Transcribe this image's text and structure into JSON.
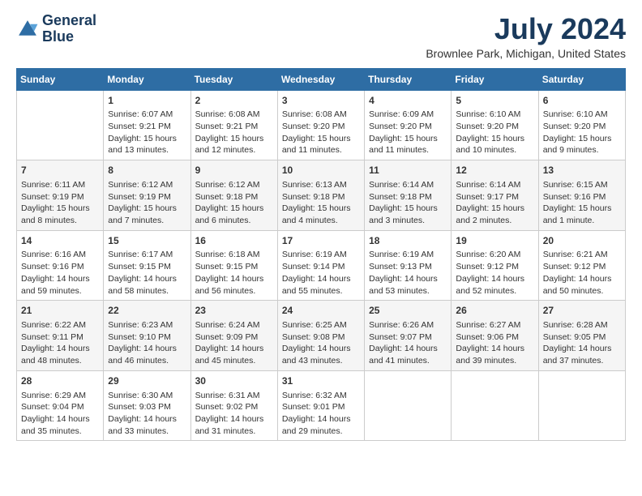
{
  "header": {
    "logo_line1": "General",
    "logo_line2": "Blue",
    "month_year": "July 2024",
    "location": "Brownlee Park, Michigan, United States"
  },
  "weekdays": [
    "Sunday",
    "Monday",
    "Tuesday",
    "Wednesday",
    "Thursday",
    "Friday",
    "Saturday"
  ],
  "weeks": [
    [
      {
        "day": "",
        "content": ""
      },
      {
        "day": "1",
        "content": "Sunrise: 6:07 AM\nSunset: 9:21 PM\nDaylight: 15 hours\nand 13 minutes."
      },
      {
        "day": "2",
        "content": "Sunrise: 6:08 AM\nSunset: 9:21 PM\nDaylight: 15 hours\nand 12 minutes."
      },
      {
        "day": "3",
        "content": "Sunrise: 6:08 AM\nSunset: 9:20 PM\nDaylight: 15 hours\nand 11 minutes."
      },
      {
        "day": "4",
        "content": "Sunrise: 6:09 AM\nSunset: 9:20 PM\nDaylight: 15 hours\nand 11 minutes."
      },
      {
        "day": "5",
        "content": "Sunrise: 6:10 AM\nSunset: 9:20 PM\nDaylight: 15 hours\nand 10 minutes."
      },
      {
        "day": "6",
        "content": "Sunrise: 6:10 AM\nSunset: 9:20 PM\nDaylight: 15 hours\nand 9 minutes."
      }
    ],
    [
      {
        "day": "7",
        "content": "Sunrise: 6:11 AM\nSunset: 9:19 PM\nDaylight: 15 hours\nand 8 minutes."
      },
      {
        "day": "8",
        "content": "Sunrise: 6:12 AM\nSunset: 9:19 PM\nDaylight: 15 hours\nand 7 minutes."
      },
      {
        "day": "9",
        "content": "Sunrise: 6:12 AM\nSunset: 9:18 PM\nDaylight: 15 hours\nand 6 minutes."
      },
      {
        "day": "10",
        "content": "Sunrise: 6:13 AM\nSunset: 9:18 PM\nDaylight: 15 hours\nand 4 minutes."
      },
      {
        "day": "11",
        "content": "Sunrise: 6:14 AM\nSunset: 9:18 PM\nDaylight: 15 hours\nand 3 minutes."
      },
      {
        "day": "12",
        "content": "Sunrise: 6:14 AM\nSunset: 9:17 PM\nDaylight: 15 hours\nand 2 minutes."
      },
      {
        "day": "13",
        "content": "Sunrise: 6:15 AM\nSunset: 9:16 PM\nDaylight: 15 hours\nand 1 minute."
      }
    ],
    [
      {
        "day": "14",
        "content": "Sunrise: 6:16 AM\nSunset: 9:16 PM\nDaylight: 14 hours\nand 59 minutes."
      },
      {
        "day": "15",
        "content": "Sunrise: 6:17 AM\nSunset: 9:15 PM\nDaylight: 14 hours\nand 58 minutes."
      },
      {
        "day": "16",
        "content": "Sunrise: 6:18 AM\nSunset: 9:15 PM\nDaylight: 14 hours\nand 56 minutes."
      },
      {
        "day": "17",
        "content": "Sunrise: 6:19 AM\nSunset: 9:14 PM\nDaylight: 14 hours\nand 55 minutes."
      },
      {
        "day": "18",
        "content": "Sunrise: 6:19 AM\nSunset: 9:13 PM\nDaylight: 14 hours\nand 53 minutes."
      },
      {
        "day": "19",
        "content": "Sunrise: 6:20 AM\nSunset: 9:12 PM\nDaylight: 14 hours\nand 52 minutes."
      },
      {
        "day": "20",
        "content": "Sunrise: 6:21 AM\nSunset: 9:12 PM\nDaylight: 14 hours\nand 50 minutes."
      }
    ],
    [
      {
        "day": "21",
        "content": "Sunrise: 6:22 AM\nSunset: 9:11 PM\nDaylight: 14 hours\nand 48 minutes."
      },
      {
        "day": "22",
        "content": "Sunrise: 6:23 AM\nSunset: 9:10 PM\nDaylight: 14 hours\nand 46 minutes."
      },
      {
        "day": "23",
        "content": "Sunrise: 6:24 AM\nSunset: 9:09 PM\nDaylight: 14 hours\nand 45 minutes."
      },
      {
        "day": "24",
        "content": "Sunrise: 6:25 AM\nSunset: 9:08 PM\nDaylight: 14 hours\nand 43 minutes."
      },
      {
        "day": "25",
        "content": "Sunrise: 6:26 AM\nSunset: 9:07 PM\nDaylight: 14 hours\nand 41 minutes."
      },
      {
        "day": "26",
        "content": "Sunrise: 6:27 AM\nSunset: 9:06 PM\nDaylight: 14 hours\nand 39 minutes."
      },
      {
        "day": "27",
        "content": "Sunrise: 6:28 AM\nSunset: 9:05 PM\nDaylight: 14 hours\nand 37 minutes."
      }
    ],
    [
      {
        "day": "28",
        "content": "Sunrise: 6:29 AM\nSunset: 9:04 PM\nDaylight: 14 hours\nand 35 minutes."
      },
      {
        "day": "29",
        "content": "Sunrise: 6:30 AM\nSunset: 9:03 PM\nDaylight: 14 hours\nand 33 minutes."
      },
      {
        "day": "30",
        "content": "Sunrise: 6:31 AM\nSunset: 9:02 PM\nDaylight: 14 hours\nand 31 minutes."
      },
      {
        "day": "31",
        "content": "Sunrise: 6:32 AM\nSunset: 9:01 PM\nDaylight: 14 hours\nand 29 minutes."
      },
      {
        "day": "",
        "content": ""
      },
      {
        "day": "",
        "content": ""
      },
      {
        "day": "",
        "content": ""
      }
    ]
  ]
}
